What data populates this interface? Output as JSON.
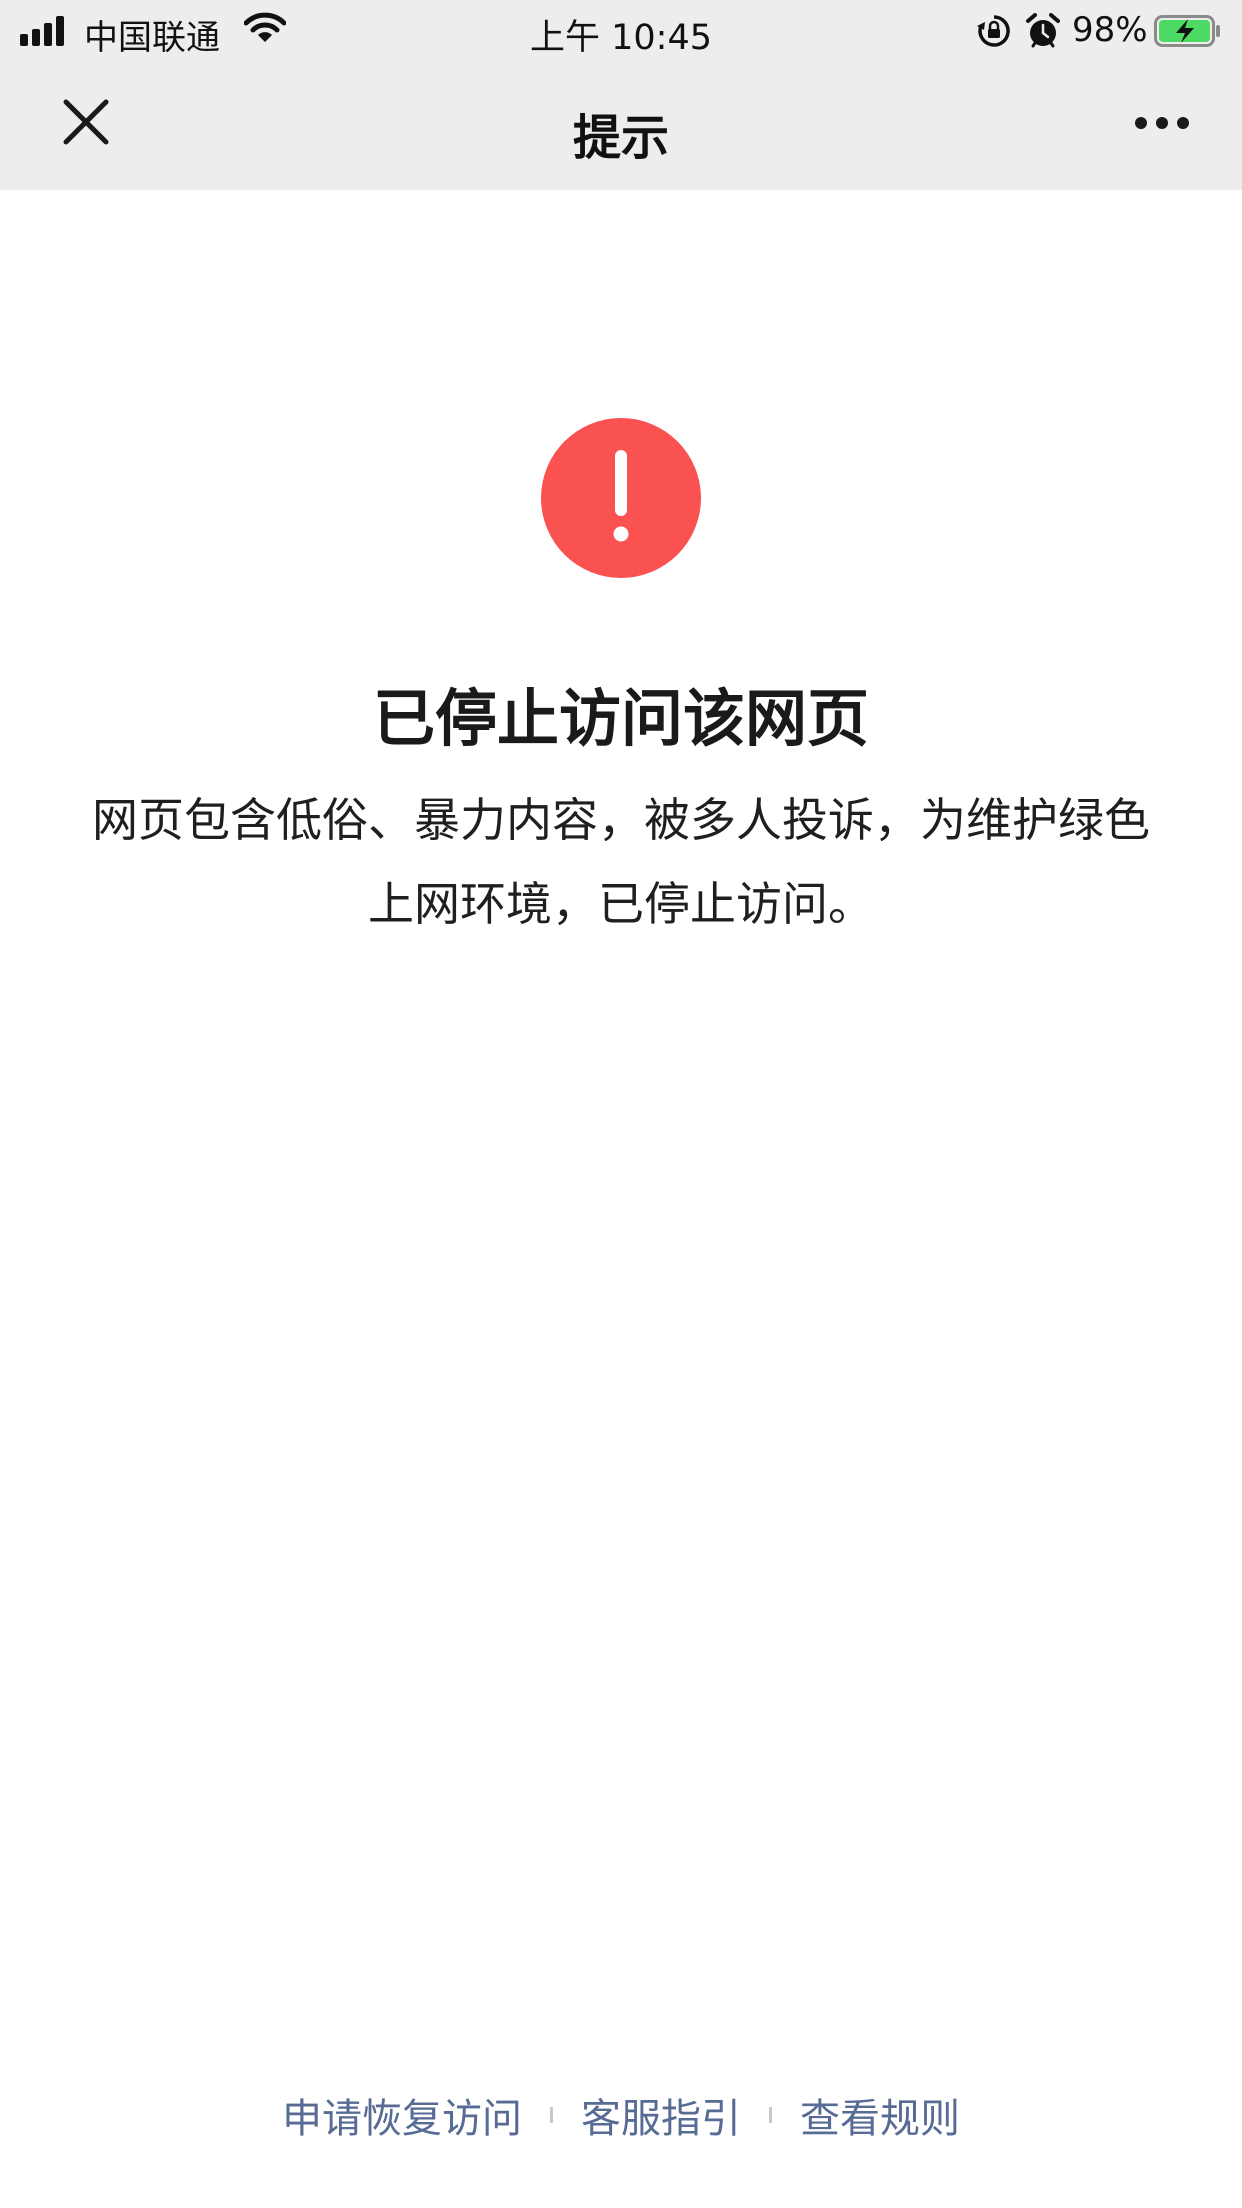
{
  "status_bar": {
    "carrier": "中国联通",
    "time": "上午 10:45",
    "battery_percent": "98%",
    "battery_level": 0.98,
    "icons": [
      "signal-icon",
      "wifi-icon",
      "orientation-lock-icon",
      "alarm-icon",
      "battery-charging-icon"
    ]
  },
  "nav": {
    "title": "提示",
    "close_icon": "close-icon",
    "more_icon": "more-icon"
  },
  "message": {
    "icon": "exclamation-icon",
    "icon_color": "#fa5151",
    "title": "已停止访问该网页",
    "description": "网页包含低俗、暴力内容，被多人投诉，为维护绿色上网环境，已停止访问。"
  },
  "footer": {
    "links": [
      "申请恢复访问",
      "客服指引",
      "查看规则"
    ],
    "link_color": "#576b95"
  }
}
